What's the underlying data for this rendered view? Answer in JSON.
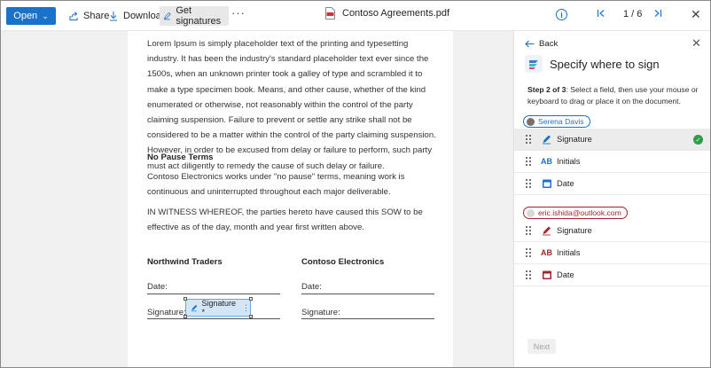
{
  "toolbar": {
    "open_label": "Open",
    "share_label": "Share",
    "download_label": "Download",
    "get_signatures_label": "Get signatures",
    "more_label": "···",
    "file_name": "Contoso Agreements.pdf",
    "page_indicator": "1 / 6",
    "accent": "#1a73c8"
  },
  "document": {
    "paragraph1": "Lorem Ipsum is simply placeholder text of the printing and typesetting industry. It has been the industry's standard placeholder text ever since the 1500s, when an unknown printer took a galley of type and scrambled it to make a type specimen book. Means, and other cause, whether of the kind enumerated or otherwise, not reasonably within the control of the party claiming suspension. Failure to prevent or settle any strike shall not be considered to be a matter within the control of the party claiming suspension. However, in order to be excused from delay or failure to perform, such party must act diligently to remedy the cause of such delay or failure.",
    "heading": "No Pause Terms",
    "paragraph2": "Contoso Electronics works under \"no pause\" terms, meaning work is continuous and uninterrupted throughout each major deliverable.",
    "paragraph3": "IN WITNESS WHEREOF, the parties hereto have caused this SOW to be effective as of the day, month and year first written above.",
    "left_party": "Northwind Traders",
    "right_party": "Contoso Electronics",
    "date_label": "Date:",
    "signature_label": "Signature:",
    "placed_field_label": "Signature *",
    "placed_field_menu": "⋮"
  },
  "panel": {
    "back_label": "Back",
    "title": "Specify where to sign",
    "step_bold": "Step 2 of 3",
    "step_text": ": Select a field, then use your mouse or keyboard to drag or place it on the document.",
    "next_label": "Next",
    "signers": [
      {
        "name": "Serena Davis",
        "color": "#1a73c8",
        "fields": [
          {
            "label": "Signature",
            "icon": "pen-icon",
            "selected": true
          },
          {
            "label": "Initials",
            "icon": "initials-icon",
            "icon_text": "AB"
          },
          {
            "label": "Date",
            "icon": "calendar-icon"
          }
        ]
      },
      {
        "name": "eric.ishida@outlook.com",
        "color": "#a4262c",
        "fields": [
          {
            "label": "Signature",
            "icon": "pen-icon"
          },
          {
            "label": "Initials",
            "icon": "initials-icon",
            "icon_text": "AB"
          },
          {
            "label": "Date",
            "icon": "calendar-icon"
          }
        ]
      }
    ]
  }
}
